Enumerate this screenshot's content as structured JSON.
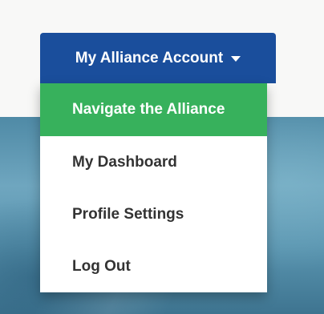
{
  "account_menu": {
    "button_label": "My Alliance Account",
    "caret_icon": "caret-down-icon",
    "items": [
      {
        "label": "Navigate the Alliance",
        "active": true
      },
      {
        "label": "My Dashboard",
        "active": false
      },
      {
        "label": "Profile Settings",
        "active": false
      },
      {
        "label": "Log Out",
        "active": false
      }
    ]
  },
  "colors": {
    "button_bg": "#1a4e9c",
    "active_item_bg": "#37b15c",
    "menu_text": "#333333"
  }
}
